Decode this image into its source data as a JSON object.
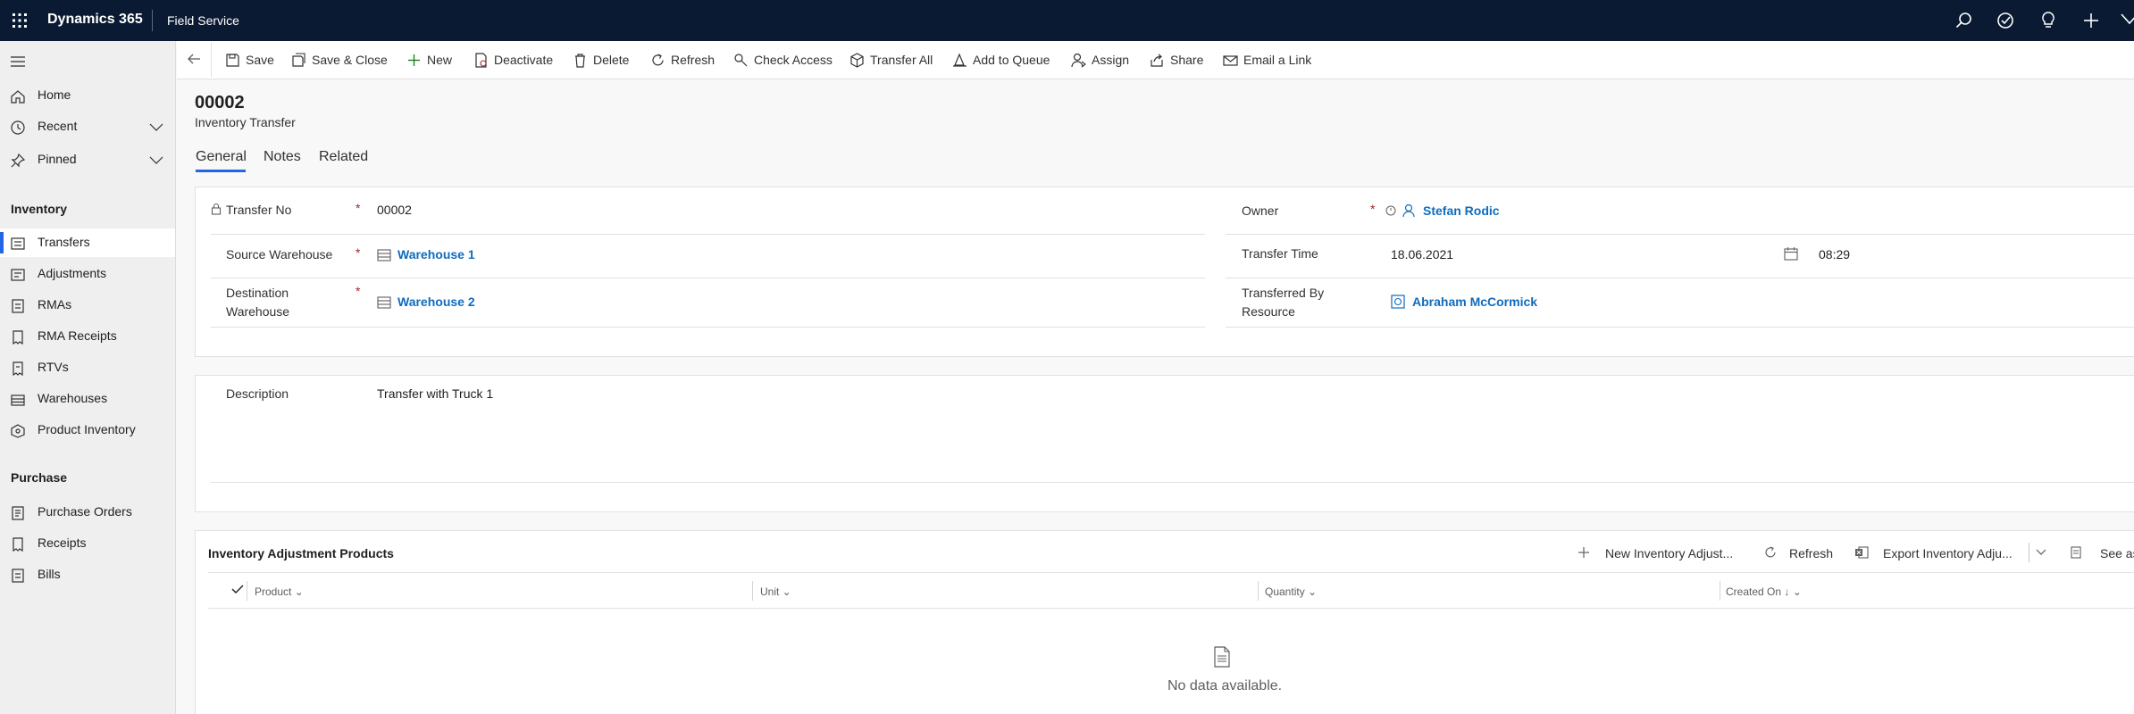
{
  "topbar": {
    "brand": "Dynamics 365",
    "app": "Field Service",
    "icons": [
      "search-icon",
      "task-icon",
      "lightbulb-icon",
      "plus-icon",
      "filter-icon"
    ]
  },
  "sidebar": {
    "top_items": [
      {
        "label": "Home",
        "icon": "home-icon"
      },
      {
        "label": "Recent",
        "icon": "clock-icon"
      },
      {
        "label": "Pinned",
        "icon": "pin-icon"
      }
    ],
    "sections": [
      {
        "title": "Inventory",
        "items": [
          {
            "label": "Transfers",
            "icon": "transfer-icon",
            "active": true
          },
          {
            "label": "Adjustments",
            "icon": "adjustment-icon"
          },
          {
            "label": "RMAs",
            "icon": "rma-icon"
          },
          {
            "label": "RMA Receipts",
            "icon": "receipt-icon"
          },
          {
            "label": "RTVs",
            "icon": "rtv-icon"
          },
          {
            "label": "Warehouses",
            "icon": "warehouse-icon"
          },
          {
            "label": "Product Inventory",
            "icon": "product-icon"
          }
        ]
      },
      {
        "title": "Purchase",
        "items": [
          {
            "label": "Purchase Orders",
            "icon": "order-icon"
          },
          {
            "label": "Receipts",
            "icon": "receipt-icon"
          },
          {
            "label": "Bills",
            "icon": "bill-icon"
          }
        ]
      }
    ]
  },
  "commandbar": {
    "items": [
      {
        "label": "Save",
        "icon": "save-icon"
      },
      {
        "label": "Save & Close",
        "icon": "save-close-icon"
      },
      {
        "label": "New",
        "icon": "plus-icon"
      },
      {
        "label": "Deactivate",
        "icon": "deactivate-icon"
      },
      {
        "label": "Delete",
        "icon": "trash-icon"
      },
      {
        "label": "Refresh",
        "icon": "refresh-icon"
      },
      {
        "label": "Check Access",
        "icon": "key-icon"
      },
      {
        "label": "Transfer All",
        "icon": "box-icon"
      },
      {
        "label": "Add to Queue",
        "icon": "queue-icon"
      },
      {
        "label": "Assign",
        "icon": "assign-icon"
      },
      {
        "label": "Share",
        "icon": "share-icon"
      },
      {
        "label": "Email a Link",
        "icon": "email-icon"
      }
    ]
  },
  "record": {
    "title": "00002",
    "entity": "Inventory Transfer",
    "tabs": [
      "General",
      "Notes",
      "Related"
    ],
    "active_tab": "General"
  },
  "form": {
    "transfer_no": {
      "label": "Transfer No",
      "value": "00002"
    },
    "source_warehouse": {
      "label": "Source Warehouse",
      "value": "Warehouse 1"
    },
    "destination_warehouse": {
      "label_line1": "Destination",
      "label_line2": "Warehouse",
      "value": "Warehouse 2"
    },
    "owner": {
      "label": "Owner",
      "value": "Stefan Rodic"
    },
    "transfer_time": {
      "label": "Transfer Time",
      "date": "18.06.2021",
      "time": "08:29"
    },
    "transferred_by": {
      "label_line1": "Transferred By",
      "label_line2": "Resource",
      "value": "Abraham McCormick"
    },
    "description": {
      "label": "Description",
      "value": "Transfer with Truck 1"
    },
    "required_mark": "*"
  },
  "grid": {
    "title": "Inventory Adjustment Products",
    "commands": {
      "new": "New Inventory Adjust...",
      "refresh": "Refresh",
      "export": "Export Inventory Adju...",
      "see_all": "See as"
    },
    "columns": [
      "Product",
      "Unit",
      "Quantity",
      "Created On"
    ],
    "empty_text": "No data available."
  }
}
